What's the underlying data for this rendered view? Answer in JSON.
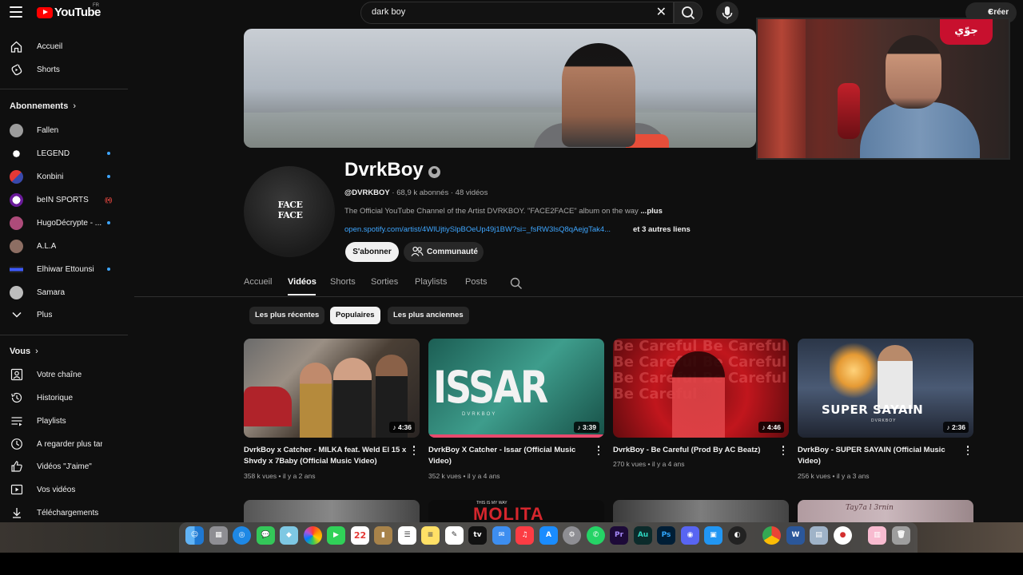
{
  "header": {
    "logo_text": "YouTube",
    "region": "FR",
    "search_value": "dark boy",
    "create_label": "Créer"
  },
  "sidebar": {
    "main": [
      {
        "label": "Accueil",
        "icon": "home-icon"
      },
      {
        "label": "Shorts",
        "icon": "shorts-icon"
      }
    ],
    "subscriptions_heading": "Abonnements",
    "subscriptions": [
      {
        "label": "Fallen",
        "color": "#9c9c9c",
        "indicator": "none"
      },
      {
        "label": "LEGEND",
        "color": "#e8e8e8",
        "indicator": "dot"
      },
      {
        "label": "Konbini",
        "color": "#e53935",
        "indicator": "dot"
      },
      {
        "label": "beIN SPORTS",
        "color": "#6a1b9a",
        "indicator": "live"
      },
      {
        "label": "HugoDécrypte - ...",
        "color": "#ad4b7a",
        "indicator": "dot"
      },
      {
        "label": "A.L.A",
        "color": "#8d6e63",
        "indicator": "none"
      },
      {
        "label": "Elhiwar Ettounsi",
        "color": "#3d5afe",
        "indicator": "dot"
      },
      {
        "label": "Samara",
        "color": "#bdbdbd",
        "indicator": "none"
      }
    ],
    "more_label": "Plus",
    "you_heading": "Vous",
    "you": [
      {
        "label": "Votre chaîne",
        "icon": "channel-icon"
      },
      {
        "label": "Historique",
        "icon": "history-icon"
      },
      {
        "label": "Playlists",
        "icon": "playlists-icon"
      },
      {
        "label": "À regarder plus tard",
        "icon": "watch-later-icon"
      },
      {
        "label": "Vidéos \"J'aime\"",
        "icon": "like-icon"
      },
      {
        "label": "Vos vidéos",
        "icon": "your-videos-icon"
      },
      {
        "label": "Téléchargements",
        "icon": "download-icon"
      }
    ]
  },
  "channel": {
    "name": "DvrkBoy",
    "avatar_text": "FACE\nFACE",
    "handle": "@DVRKBOY",
    "subscribers": "68,9 k abonnés",
    "videos_count": "48 vidéos",
    "description": "The Official YouTube Channel of the Artist DVRKBOY. \"FACE2FACE\" album on the way",
    "description_more": "...plus",
    "link": "open.spotify.com/artist/4WlUjtiySlpBOeUp49j1BW?si=_fsRW3lsQ8qAejgTak4...",
    "more_links": "et 3 autres liens",
    "subscribe_label": "S'abonner",
    "community_label": "Communauté"
  },
  "tabs": [
    "Accueil",
    "Vidéos",
    "Shorts",
    "Sorties",
    "Playlists",
    "Posts"
  ],
  "active_tab": "Vidéos",
  "chips": [
    "Les plus récentes",
    "Populaires",
    "Les plus anciennes"
  ],
  "active_chip": "Populaires",
  "videos": [
    {
      "title": "DvrkBoy x Catcher - MILKA feat. Weld El 15 x Shvdy x 7Baby (Official Music Video)",
      "views": "358 k vues",
      "age": "il y a 2 ans",
      "duration": "4:36",
      "two_line": true
    },
    {
      "title": "DvrkBoy X Catcher - Issar (Official Music Video)",
      "views": "352 k vues",
      "age": "il y a 4 ans",
      "duration": "3:39",
      "two_line": true,
      "thumb_text": "ISSAR",
      "thumb_sub": "DVRKBOY"
    },
    {
      "title": "DvrkBoy - Be Careful (Prod By AC Beatz)",
      "views": "270 k vues",
      "age": "il y a 4 ans",
      "duration": "4:46",
      "two_line": false,
      "thumb_text": "Be Careful Be Careful Be Careful Be Careful Be Careful Be Careful Be Careful"
    },
    {
      "title": "DvrkBoy - SUPER SAYAIN (Official Music Video)",
      "views": "256 k vues",
      "age": "il y a 3 ans",
      "duration": "2:36",
      "two_line": true,
      "thumb_text": "SUPER SAYAIN",
      "thumb_sub": "DVRKBOY"
    }
  ],
  "row2": {
    "thumb2_text": "MOLITA",
    "thumb2_sub": "THIS IS MY WAY",
    "thumb4_text": "Tay7a l 3rnin"
  },
  "webcam_badge": "جوّي",
  "dock": {
    "calendar_day": "22"
  }
}
